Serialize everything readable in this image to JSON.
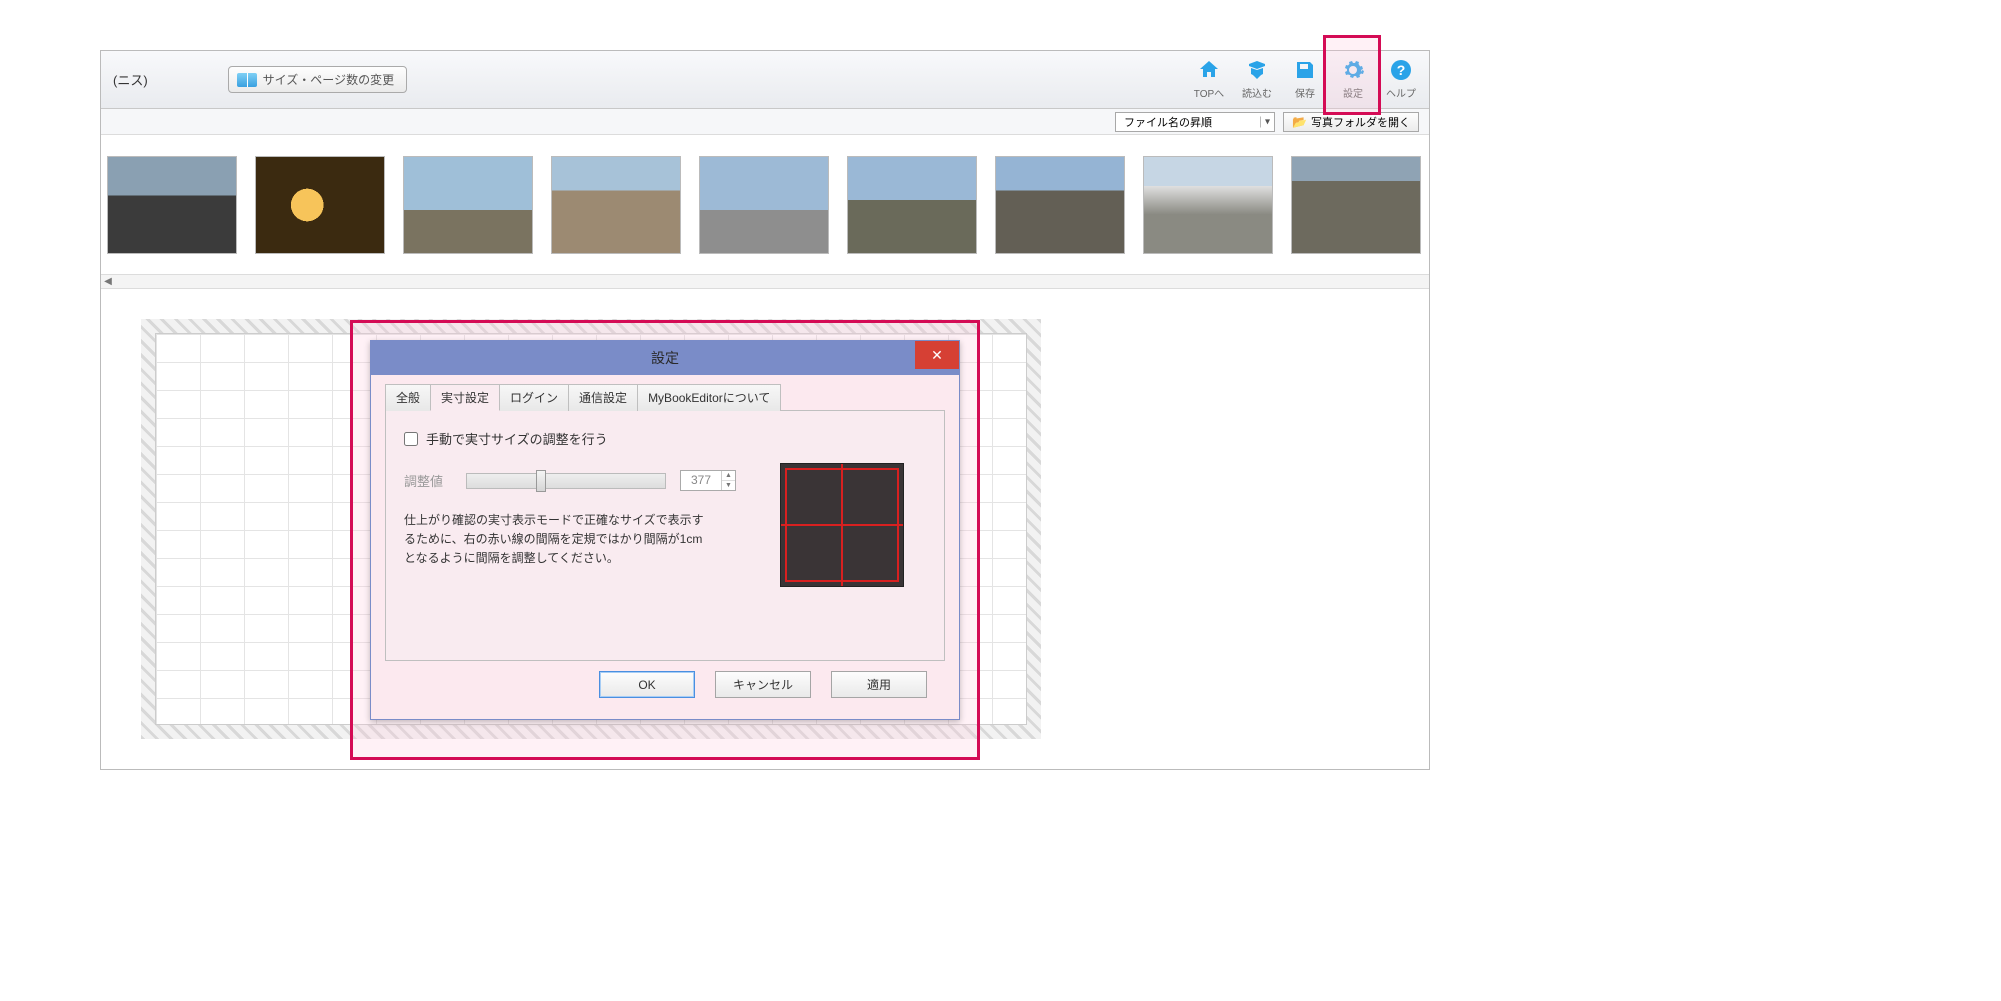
{
  "toolbar": {
    "truncated_label": "(ニス)",
    "size_change_label": "サイズ・ページ数の変更",
    "icons": {
      "top": "TOPへ",
      "load": "読込む",
      "save": "保存",
      "settings": "設定",
      "help": "ヘルプ"
    }
  },
  "filter": {
    "sort_selected": "ファイル名の昇順",
    "open_folder": "写真フォルダを開く"
  },
  "dialog": {
    "title": "設定",
    "tabs": {
      "general": "全般",
      "size": "実寸設定",
      "login": "ログイン",
      "comm": "通信設定",
      "about": "MyBookEditorについて"
    },
    "checkbox_label": "手動で実寸サイズの調整を行う",
    "adjust_label": "調整値",
    "adjust_value": "377",
    "help_text": "仕上がり確認の実寸表示モードで正確なサイズで表示するために、右の赤い線の間隔を定規ではかり間隔が1cmとなるように間隔を調整してください。",
    "ok": "OK",
    "cancel": "キャンセル",
    "apply": "適用"
  }
}
